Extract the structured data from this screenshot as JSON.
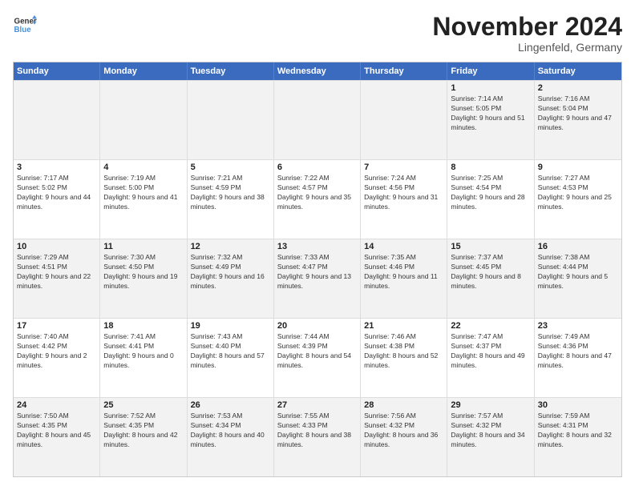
{
  "logo": {
    "line1": "General",
    "line2": "Blue"
  },
  "title": "November 2024",
  "location": "Lingenfeld, Germany",
  "days_of_week": [
    "Sunday",
    "Monday",
    "Tuesday",
    "Wednesday",
    "Thursday",
    "Friday",
    "Saturday"
  ],
  "rows": [
    [
      {
        "day": "",
        "empty": true
      },
      {
        "day": "",
        "empty": true
      },
      {
        "day": "",
        "empty": true
      },
      {
        "day": "",
        "empty": true
      },
      {
        "day": "",
        "empty": true
      },
      {
        "day": "1",
        "sunrise": "Sunrise: 7:14 AM",
        "sunset": "Sunset: 5:05 PM",
        "daylight": "Daylight: 9 hours and 51 minutes."
      },
      {
        "day": "2",
        "sunrise": "Sunrise: 7:16 AM",
        "sunset": "Sunset: 5:04 PM",
        "daylight": "Daylight: 9 hours and 47 minutes."
      }
    ],
    [
      {
        "day": "3",
        "sunrise": "Sunrise: 7:17 AM",
        "sunset": "Sunset: 5:02 PM",
        "daylight": "Daylight: 9 hours and 44 minutes."
      },
      {
        "day": "4",
        "sunrise": "Sunrise: 7:19 AM",
        "sunset": "Sunset: 5:00 PM",
        "daylight": "Daylight: 9 hours and 41 minutes."
      },
      {
        "day": "5",
        "sunrise": "Sunrise: 7:21 AM",
        "sunset": "Sunset: 4:59 PM",
        "daylight": "Daylight: 9 hours and 38 minutes."
      },
      {
        "day": "6",
        "sunrise": "Sunrise: 7:22 AM",
        "sunset": "Sunset: 4:57 PM",
        "daylight": "Daylight: 9 hours and 35 minutes."
      },
      {
        "day": "7",
        "sunrise": "Sunrise: 7:24 AM",
        "sunset": "Sunset: 4:56 PM",
        "daylight": "Daylight: 9 hours and 31 minutes."
      },
      {
        "day": "8",
        "sunrise": "Sunrise: 7:25 AM",
        "sunset": "Sunset: 4:54 PM",
        "daylight": "Daylight: 9 hours and 28 minutes."
      },
      {
        "day": "9",
        "sunrise": "Sunrise: 7:27 AM",
        "sunset": "Sunset: 4:53 PM",
        "daylight": "Daylight: 9 hours and 25 minutes."
      }
    ],
    [
      {
        "day": "10",
        "sunrise": "Sunrise: 7:29 AM",
        "sunset": "Sunset: 4:51 PM",
        "daylight": "Daylight: 9 hours and 22 minutes."
      },
      {
        "day": "11",
        "sunrise": "Sunrise: 7:30 AM",
        "sunset": "Sunset: 4:50 PM",
        "daylight": "Daylight: 9 hours and 19 minutes."
      },
      {
        "day": "12",
        "sunrise": "Sunrise: 7:32 AM",
        "sunset": "Sunset: 4:49 PM",
        "daylight": "Daylight: 9 hours and 16 minutes."
      },
      {
        "day": "13",
        "sunrise": "Sunrise: 7:33 AM",
        "sunset": "Sunset: 4:47 PM",
        "daylight": "Daylight: 9 hours and 13 minutes."
      },
      {
        "day": "14",
        "sunrise": "Sunrise: 7:35 AM",
        "sunset": "Sunset: 4:46 PM",
        "daylight": "Daylight: 9 hours and 11 minutes."
      },
      {
        "day": "15",
        "sunrise": "Sunrise: 7:37 AM",
        "sunset": "Sunset: 4:45 PM",
        "daylight": "Daylight: 9 hours and 8 minutes."
      },
      {
        "day": "16",
        "sunrise": "Sunrise: 7:38 AM",
        "sunset": "Sunset: 4:44 PM",
        "daylight": "Daylight: 9 hours and 5 minutes."
      }
    ],
    [
      {
        "day": "17",
        "sunrise": "Sunrise: 7:40 AM",
        "sunset": "Sunset: 4:42 PM",
        "daylight": "Daylight: 9 hours and 2 minutes."
      },
      {
        "day": "18",
        "sunrise": "Sunrise: 7:41 AM",
        "sunset": "Sunset: 4:41 PM",
        "daylight": "Daylight: 9 hours and 0 minutes."
      },
      {
        "day": "19",
        "sunrise": "Sunrise: 7:43 AM",
        "sunset": "Sunset: 4:40 PM",
        "daylight": "Daylight: 8 hours and 57 minutes."
      },
      {
        "day": "20",
        "sunrise": "Sunrise: 7:44 AM",
        "sunset": "Sunset: 4:39 PM",
        "daylight": "Daylight: 8 hours and 54 minutes."
      },
      {
        "day": "21",
        "sunrise": "Sunrise: 7:46 AM",
        "sunset": "Sunset: 4:38 PM",
        "daylight": "Daylight: 8 hours and 52 minutes."
      },
      {
        "day": "22",
        "sunrise": "Sunrise: 7:47 AM",
        "sunset": "Sunset: 4:37 PM",
        "daylight": "Daylight: 8 hours and 49 minutes."
      },
      {
        "day": "23",
        "sunrise": "Sunrise: 7:49 AM",
        "sunset": "Sunset: 4:36 PM",
        "daylight": "Daylight: 8 hours and 47 minutes."
      }
    ],
    [
      {
        "day": "24",
        "sunrise": "Sunrise: 7:50 AM",
        "sunset": "Sunset: 4:35 PM",
        "daylight": "Daylight: 8 hours and 45 minutes."
      },
      {
        "day": "25",
        "sunrise": "Sunrise: 7:52 AM",
        "sunset": "Sunset: 4:35 PM",
        "daylight": "Daylight: 8 hours and 42 minutes."
      },
      {
        "day": "26",
        "sunrise": "Sunrise: 7:53 AM",
        "sunset": "Sunset: 4:34 PM",
        "daylight": "Daylight: 8 hours and 40 minutes."
      },
      {
        "day": "27",
        "sunrise": "Sunrise: 7:55 AM",
        "sunset": "Sunset: 4:33 PM",
        "daylight": "Daylight: 8 hours and 38 minutes."
      },
      {
        "day": "28",
        "sunrise": "Sunrise: 7:56 AM",
        "sunset": "Sunset: 4:32 PM",
        "daylight": "Daylight: 8 hours and 36 minutes."
      },
      {
        "day": "29",
        "sunrise": "Sunrise: 7:57 AM",
        "sunset": "Sunset: 4:32 PM",
        "daylight": "Daylight: 8 hours and 34 minutes."
      },
      {
        "day": "30",
        "sunrise": "Sunrise: 7:59 AM",
        "sunset": "Sunset: 4:31 PM",
        "daylight": "Daylight: 8 hours and 32 minutes."
      }
    ]
  ],
  "alt_rows": [
    0,
    2,
    4
  ]
}
